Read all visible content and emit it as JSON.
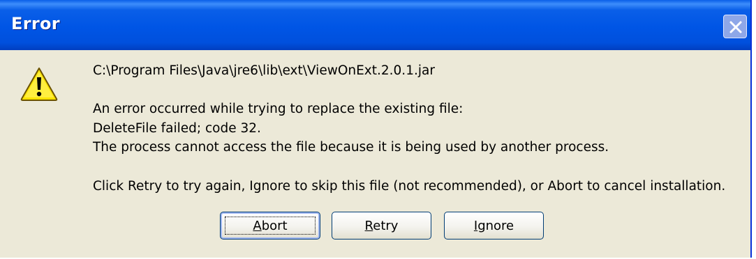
{
  "window": {
    "title": "Error"
  },
  "icons": {
    "title_close": "close-icon",
    "message": "warning-icon"
  },
  "colors": {
    "titlebar": "#0055e5",
    "dialog_bg": "#ece9d8",
    "button_border": "#003c74"
  },
  "message": {
    "path": "C:\\Program Files\\Java\\jre6\\lib\\ext\\ViewOnExt.2.0.1.jar",
    "line1": "An error occurred while trying to replace the existing file:",
    "line2": "DeleteFile failed; code 32.",
    "line3": "The process cannot access the file because it is being used by another process.",
    "line4": "Click Retry to try again, Ignore to skip this file (not recommended), or Abort to cancel installation."
  },
  "buttons": {
    "abort": {
      "key": "A",
      "rest": "bort"
    },
    "retry": {
      "key": "R",
      "rest": "etry"
    },
    "ignore": {
      "key": "I",
      "rest": "gnore"
    }
  }
}
